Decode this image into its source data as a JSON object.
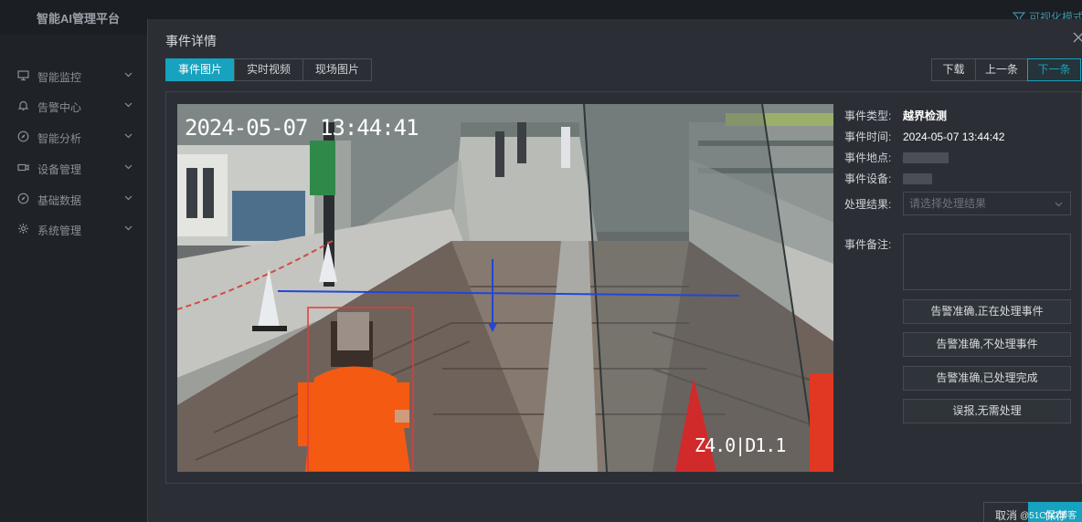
{
  "header": {
    "brand": "智能AI管理平台",
    "mode_toggle": "可视化模式"
  },
  "sidebar": {
    "items": [
      {
        "label": "智能监控",
        "icon": "monitor-icon"
      },
      {
        "label": "告警中心",
        "icon": "bell-icon"
      },
      {
        "label": "智能分析",
        "icon": "compass-icon"
      },
      {
        "label": "设备管理",
        "icon": "camera-icon"
      },
      {
        "label": "基础数据",
        "icon": "compass-icon"
      },
      {
        "label": "系统管理",
        "icon": "gear-icon"
      }
    ]
  },
  "modal": {
    "title": "事件详情",
    "tabs": [
      {
        "label": "事件图片",
        "active": true
      },
      {
        "label": "实时视频",
        "active": false
      },
      {
        "label": "现场图片",
        "active": false
      }
    ],
    "nav": {
      "download": "下载",
      "prev": "上一条",
      "next": "下一条"
    },
    "image": {
      "timestamp": "2024-05-07 13:44:41",
      "camera_code": "Z4.0|D1.1"
    },
    "info": {
      "type_label": "事件类型:",
      "type_value": "越界检测",
      "time_label": "事件时间:",
      "time_value": "2024-05-07 13:44:42",
      "location_label": "事件地点:",
      "device_label": "事件设备:",
      "result_label": "处理结果:",
      "result_placeholder": "请选择处理结果",
      "remark_label": "事件备注:"
    },
    "actions": [
      "告警准确,正在处理事件",
      "告警准确,不处理事件",
      "告警准确,已处理完成",
      "误报,无需处理"
    ],
    "footer": {
      "cancel": "取消",
      "save": "保存"
    }
  },
  "watermark": "@51CTO博客",
  "colors": {
    "accent": "#17a2bf",
    "detection_box": "#e23b3b",
    "tripwire": "#2346d6"
  }
}
